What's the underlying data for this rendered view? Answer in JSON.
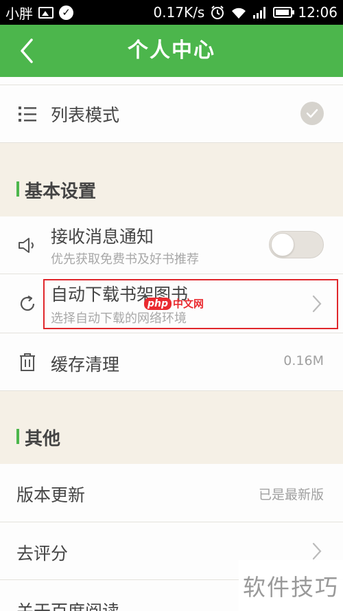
{
  "status_bar": {
    "carrier": "小胖",
    "speed": "0.17K/s",
    "time": "12:06"
  },
  "header": {
    "title": "个人中心"
  },
  "list_mode": {
    "label": "列表模式"
  },
  "sections": {
    "basic": "基本设置",
    "other": "其他"
  },
  "notifications": {
    "title": "接收消息通知",
    "subtitle": "优先获取免费书及好书推荐",
    "enabled": false
  },
  "auto_download": {
    "title": "自动下载书架图书",
    "subtitle": "选择自动下载的网络环境"
  },
  "cache": {
    "title": "缓存清理",
    "value": "0.16M"
  },
  "version": {
    "title": "版本更新",
    "value": "已是最新版"
  },
  "rate": {
    "title": "去评分"
  },
  "about": {
    "title": "关于百度阅读"
  },
  "watermarks": {
    "php_badge": "php",
    "php_text": "中文网",
    "corner": "软件技巧"
  },
  "colors": {
    "accent": "#4cb64c",
    "highlight": "#e0262b"
  }
}
